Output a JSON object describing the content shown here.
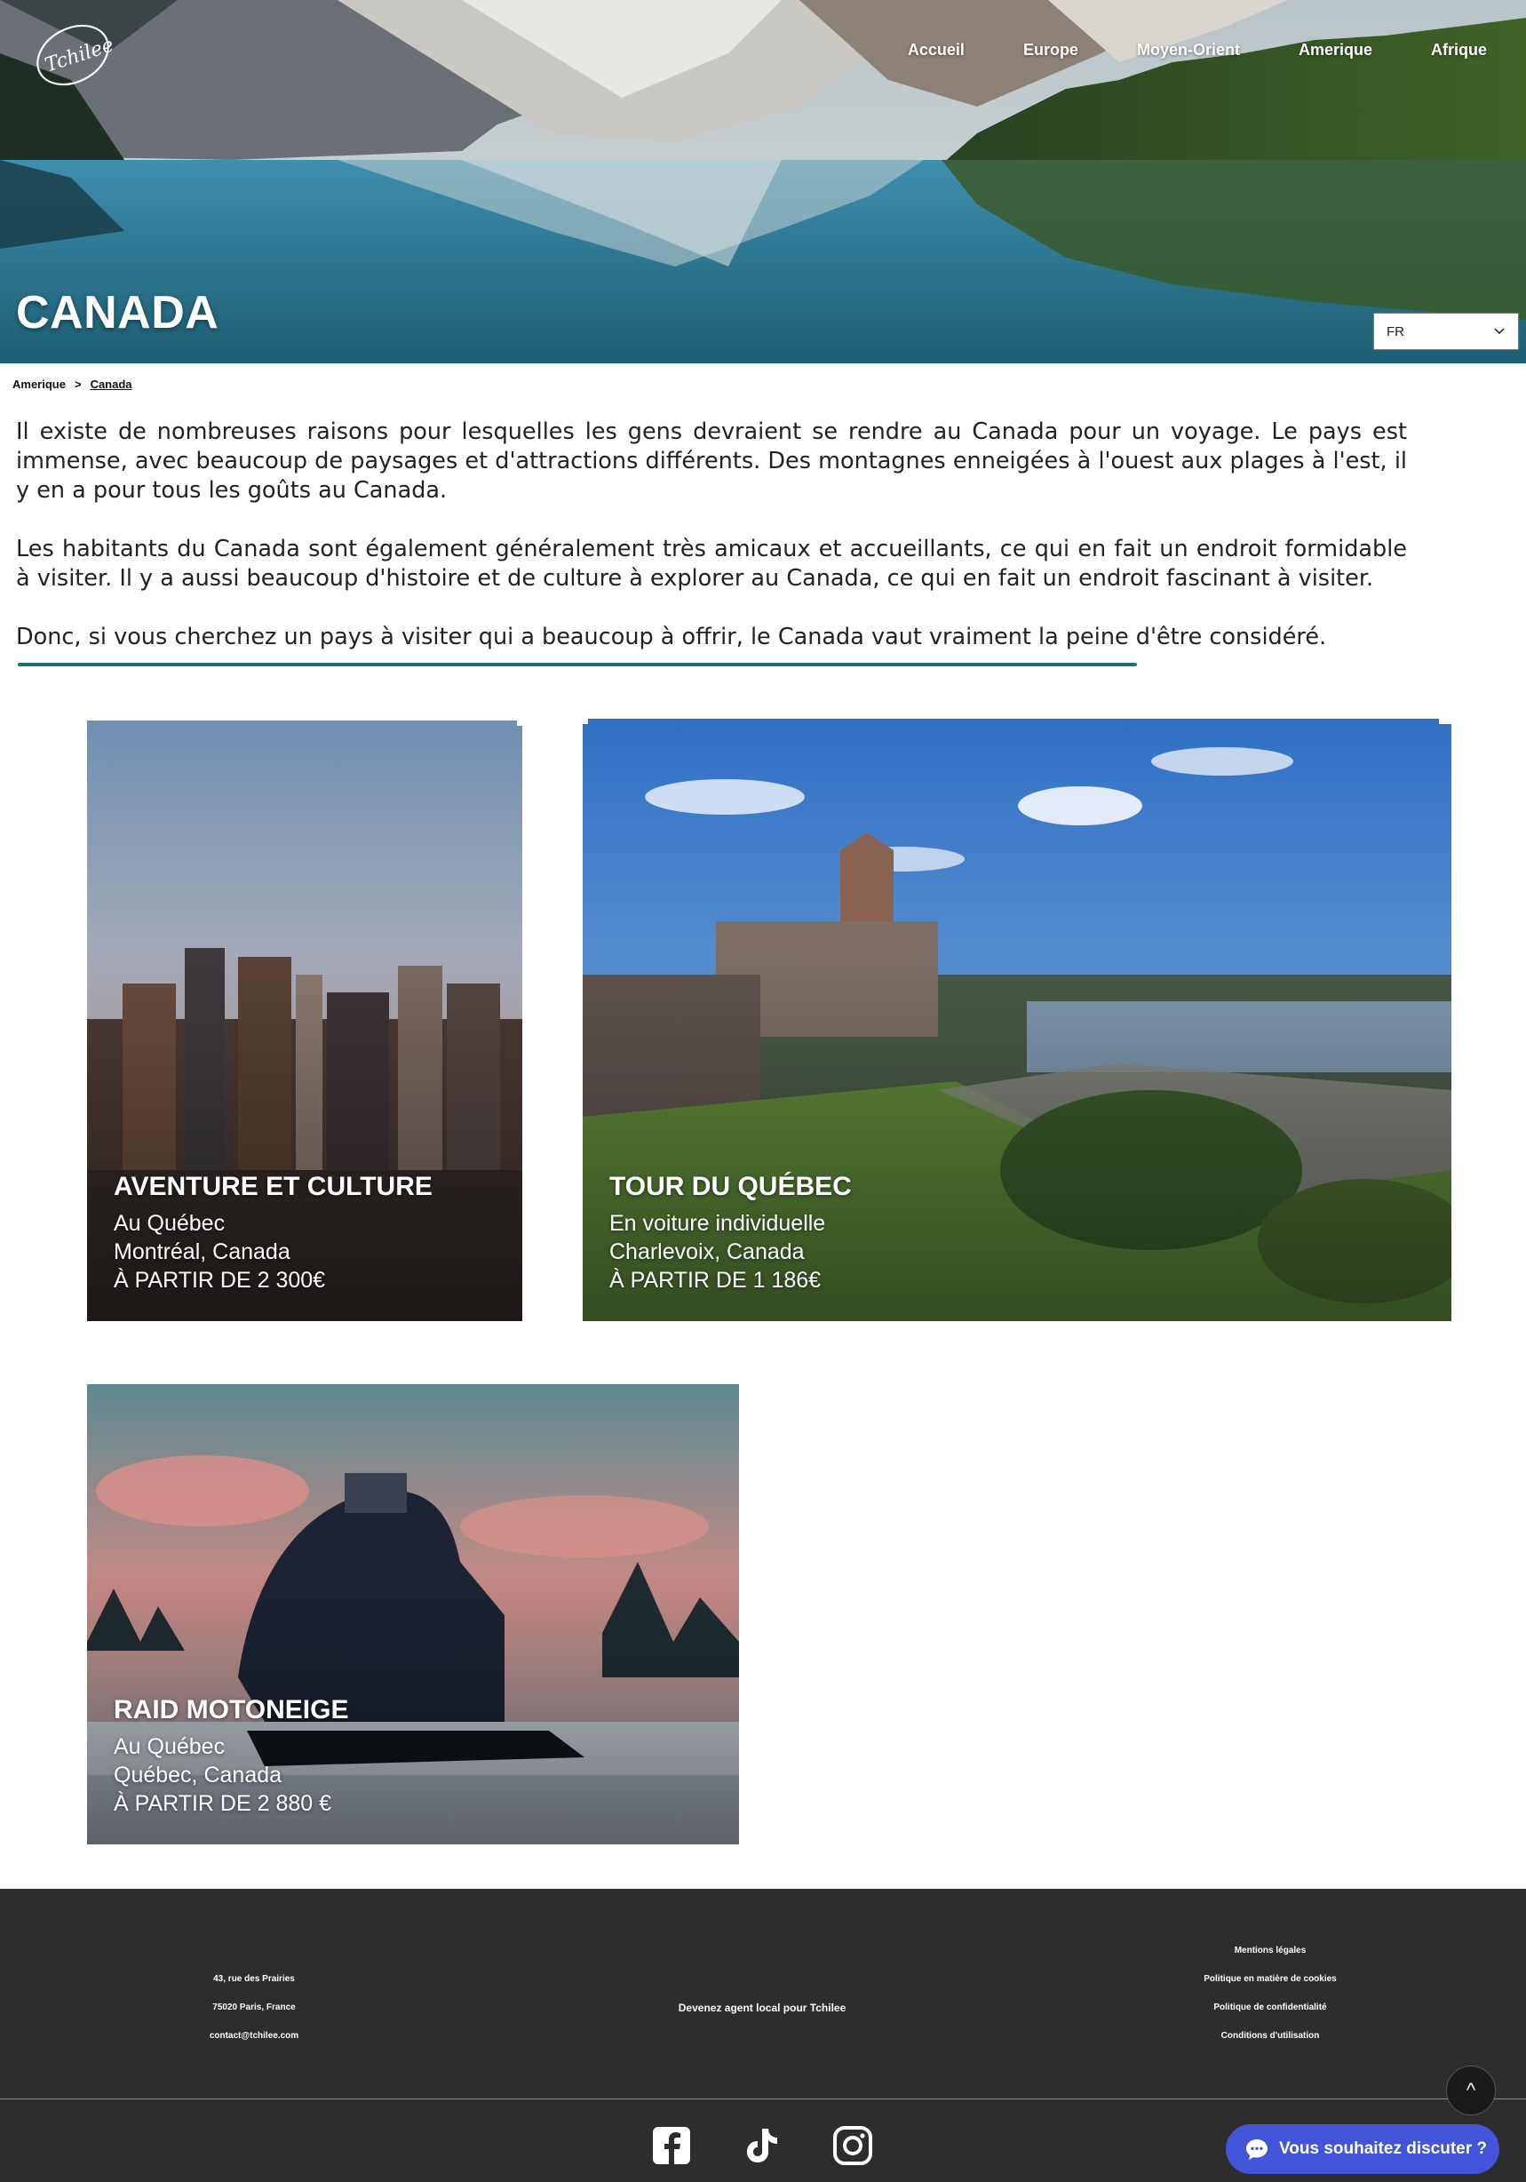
{
  "brand": {
    "logo_text": "Tchilee"
  },
  "nav": {
    "items": [
      "Accueil",
      "Europe",
      "Moyen-Orient",
      "Amerique",
      "Afrique"
    ]
  },
  "hero": {
    "title": "CANADA"
  },
  "lang_select": {
    "value": "FR"
  },
  "breadcrumb": {
    "parent": "Amerique",
    "separator": ">",
    "current": "Canada"
  },
  "intro": {
    "p1": "Il existe de nombreuses raisons pour lesquelles les gens devraient se rendre au Canada pour un voyage. Le pays est immense, avec beaucoup de paysages et d'attractions différents. Des montagnes enneigées à l'ouest aux plages à l'est, il y en a pour tous les goûts au Canada.",
    "p2": "Les habitants du Canada sont également généralement très amicaux et accueillants, ce qui en fait un endroit formidable à visiter. Il y a aussi beaucoup d'histoire et de culture à explorer au Canada, ce qui en fait un endroit fascinant à visiter.",
    "p3": "Donc, si vous cherchez un pays à visiter qui a beaucoup à offrir, le Canada vaut vraiment la peine d'être considéré."
  },
  "cards": [
    {
      "title": "AVENTURE ET CULTURE",
      "subtitle": "Au Québec",
      "location": "Montréal, Canada",
      "price": "À PARTIR DE 2 300€"
    },
    {
      "title": "TOUR DU QUÉBEC",
      "subtitle": "En voiture individuelle",
      "location": "Charlevoix, Canada",
      "price": "À PARTIR DE 1 186€"
    },
    {
      "title": "RAID MOTONEIGE",
      "subtitle": "Au Québec",
      "location": "Québec, Canada",
      "price": "À PARTIR DE 2 880 €"
    }
  ],
  "footer": {
    "address": [
      "43, rue des Prairies",
      "75020 Paris, France",
      "contact@tchilee.com"
    ],
    "agent_link": "Devenez agent local pour Tchilee",
    "legal": [
      "Mentions légales",
      "Politique en matière de cookies",
      "Politique de confidentialité",
      "Conditions d'utilisation"
    ],
    "social_icons": [
      "facebook-icon",
      "tiktok-icon",
      "instagram-icon"
    ]
  },
  "scroll_top": {
    "label": "^"
  },
  "chat": {
    "label": "Vous souhaitez discuter ?"
  },
  "colors": {
    "accent_underline": "#1c6f78",
    "footer_bg": "#2d2d2d",
    "chat_bg": "#4254d8"
  }
}
